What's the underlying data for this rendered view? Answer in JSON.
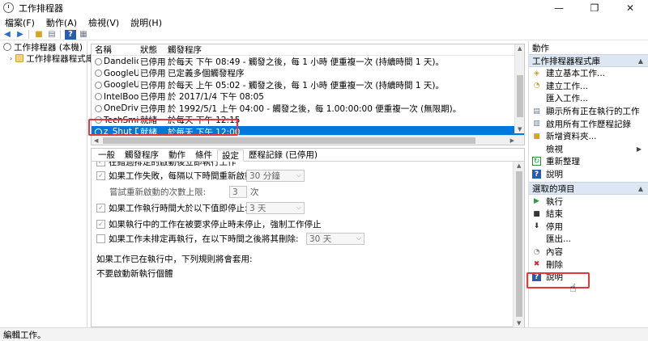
{
  "window": {
    "title": "工作排程器",
    "minimize": "—",
    "maximize": "❐",
    "close": "✕"
  },
  "menu": [
    "檔案(F)",
    "動作(A)",
    "檢視(V)",
    "說明(H)"
  ],
  "tree": {
    "root": "工作排程器 (本機)",
    "library": "工作排程器程式庫"
  },
  "task_list": {
    "columns": {
      "name": "名稱",
      "status": "狀態",
      "trigger": "觸發程序"
    },
    "rows": [
      {
        "name": "Dandelio...",
        "status": "已停用",
        "trigger": "於每天 下午 08:49 - 觸發之後，每 1 小時 便重複一次 (持續時間 1 天)。"
      },
      {
        "name": "GoogleU...",
        "status": "已停用",
        "trigger": "已定義多個觸發程序"
      },
      {
        "name": "GoogleU...",
        "status": "已停用",
        "trigger": "於每天 上午 05:02 - 觸發之後，每 1 小時 便重複一次 (持續時間 1 天)。"
      },
      {
        "name": "IntelBoot...",
        "status": "已停用",
        "trigger": "於 2017/1/4 下午 08:05"
      },
      {
        "name": "OneDrive...",
        "status": "已停用",
        "trigger": "於 1992/5/1 上午 04:00 - 觸發之後，每 1.00:00:00 便重複一次 (無限期)。"
      },
      {
        "name": "TechSmit...",
        "status": "就緒",
        "trigger": "於每天 下午 12:15"
      },
      {
        "name": "z_Shut D...",
        "status": "就緒",
        "trigger": "於每天 下午 12:00"
      }
    ]
  },
  "tabs": [
    "一般",
    "觸發程序",
    "動作",
    "條件",
    "設定",
    "歷程記錄 (已停用)"
  ],
  "settings": {
    "partial_top": "在錯過排定的啟動後立即執行工作",
    "restart_on_fail": "如果工作失敗，每隔以下時間重新啟動:",
    "restart_interval": "30 分鐘",
    "restart_attempts_label": "嘗試重新啟動的次數上限:",
    "restart_attempts": "3",
    "restart_attempts_unit": "次",
    "stop_if_longer": "如果工作執行時間大於以下值即停止:",
    "stop_duration": "3 天",
    "force_stop": "如果執行中的工作在被要求停止時未停止，強制工作停止",
    "delete_if_not_scheduled": "如果工作未排定再執行，在以下時間之後將其刪除:",
    "delete_after": "30 天",
    "running_rule_label": "如果工作已在執行中，下列規則將會套用:",
    "running_rule_value": "不要啟動新執行個體"
  },
  "actions": {
    "title": "動作",
    "library_section": "工作排程器程式庫",
    "library_items": [
      "建立基本工作...",
      "建立工作...",
      "匯入工作...",
      "顯示所有正在執行的工作",
      "啟用所有工作歷程記錄",
      "新增資料夾...",
      "檢視",
      "重新整理",
      "說明"
    ],
    "selected_section": "選取的項目",
    "selected_items": [
      "執行",
      "結束",
      "停用",
      "匯出...",
      "內容",
      "刪除",
      "說明"
    ]
  },
  "status_bar": "編輯工作。"
}
